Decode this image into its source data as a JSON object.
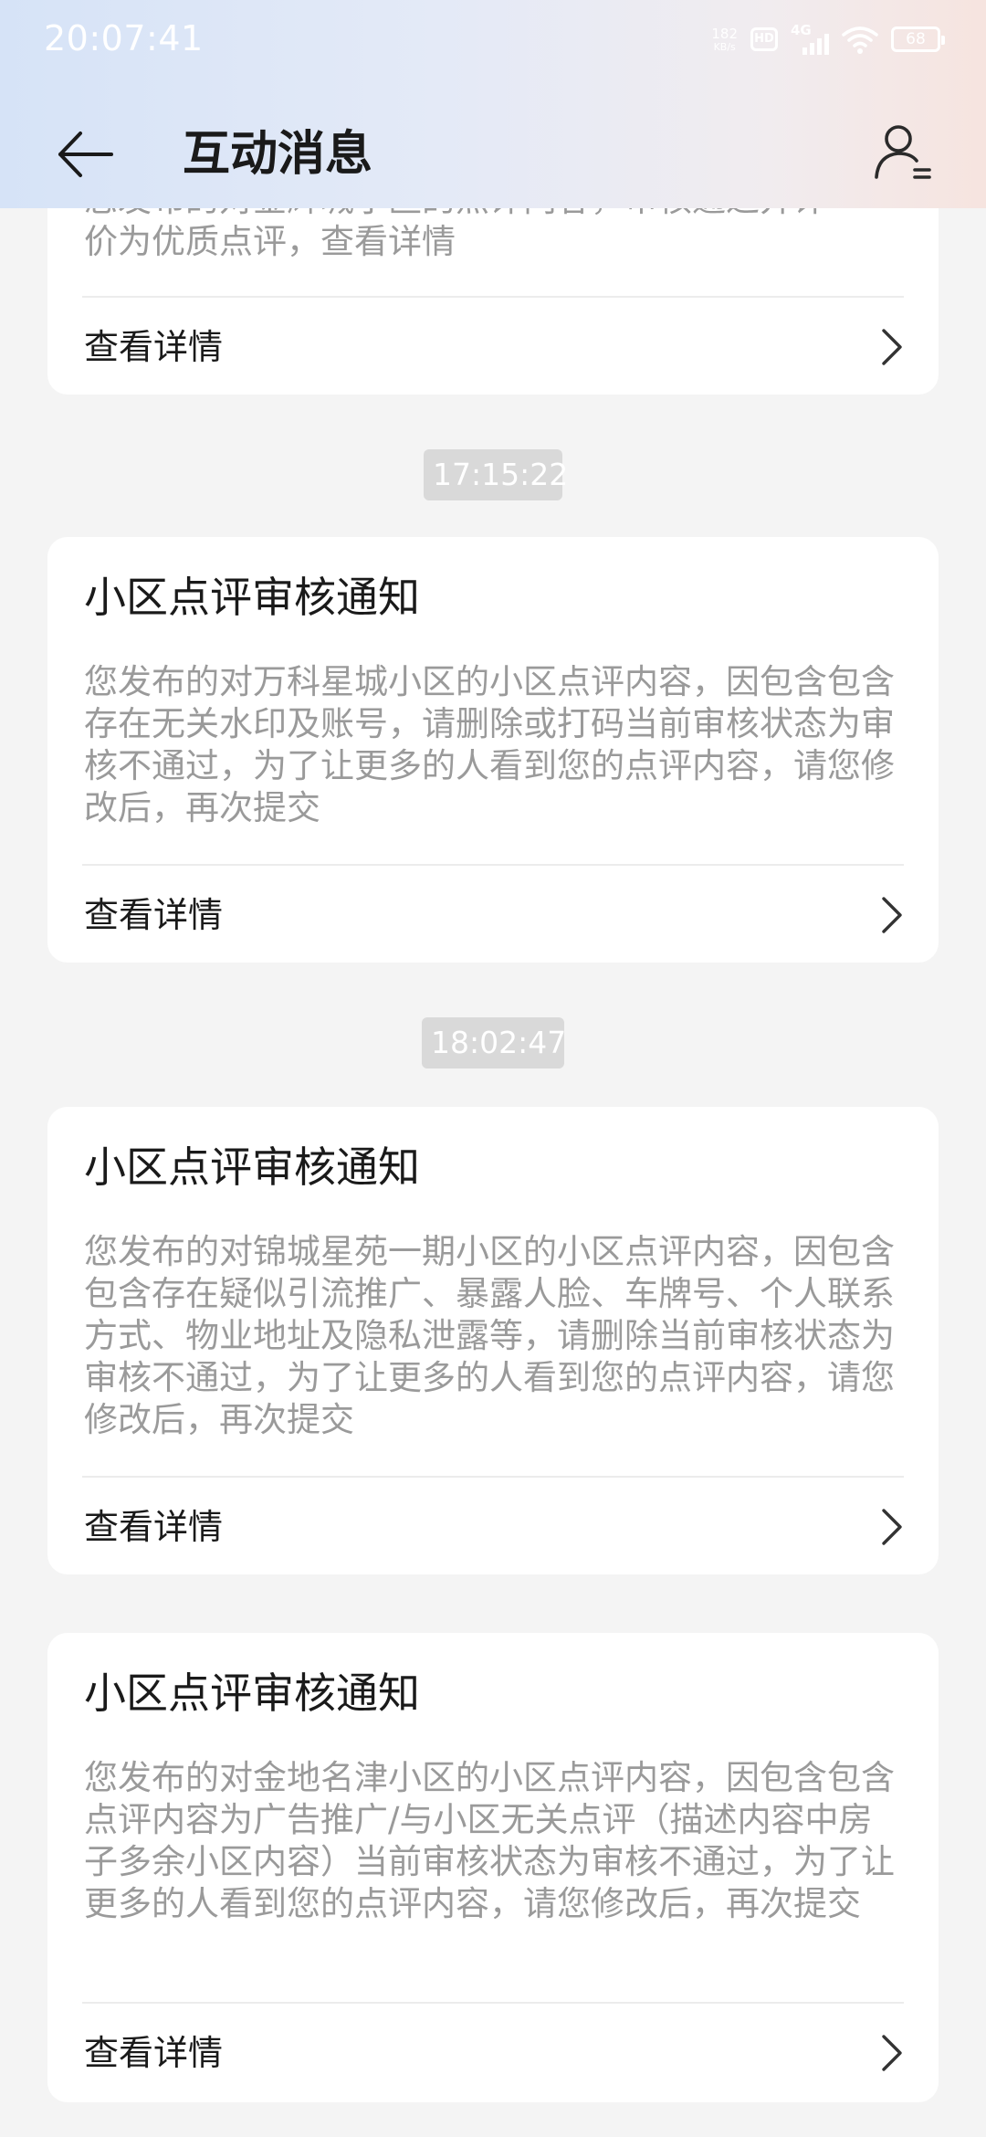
{
  "status_bar": {
    "time": "20:07:41",
    "net_speed_value": "182",
    "net_speed_unit": "KB/s",
    "hd_label": "HD",
    "network_type": "4G",
    "battery_level": "68"
  },
  "nav": {
    "title": "互动消息"
  },
  "partial_card": {
    "body_clipped": "您发布的对金辉城小区的点评内容，审核通过并评",
    "body_last_line": "价为优质点评，查看详情",
    "detail_label": "查看详情"
  },
  "messages": [
    {
      "time": "17:15:22",
      "title": "小区点评审核通知",
      "body": "您发布的对万科星城小区的小区点评内容，因包含包含存在无关水印及账号，请删除或打码当前审核状态为审核不通过，为了让更多的人看到您的点评内容，请您修改后，再次提交",
      "detail_label": "查看详情"
    },
    {
      "time": "18:02:47",
      "title": "小区点评审核通知",
      "body": "您发布的对锦城星苑一期小区的小区点评内容，因包含包含存在疑似引流推广、暴露人脸、车牌号、个人联系方式、物业地址及隐私泄露等，请删除当前审核状态为审核不通过，为了让更多的人看到您的点评内容，请您修改后，再次提交",
      "detail_label": "查看详情"
    },
    {
      "title": "小区点评审核通知",
      "body": "您发布的对金地名津小区的小区点评内容，因包含包含点评内容为广告推广/与小区无关点评（描述内容中房子多余小区内容）当前审核状态为审核不通过，为了让更多的人看到您的点评内容，请您修改后，再次提交",
      "detail_label": "查看详情"
    }
  ]
}
